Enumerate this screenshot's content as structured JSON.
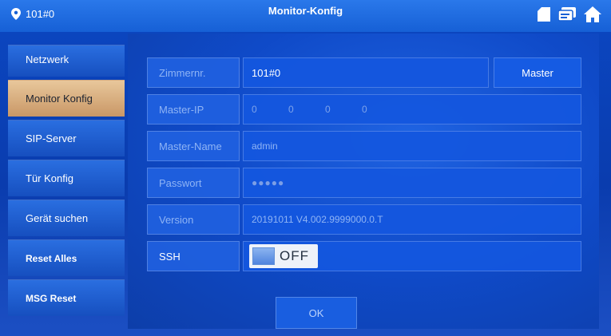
{
  "topbar": {
    "room": "101#0",
    "title": "Monitor-Konfig",
    "icons": [
      "sd-card-icon",
      "message-icon",
      "home-icon"
    ]
  },
  "sidebar": {
    "items": [
      {
        "label": "Netzwerk"
      },
      {
        "label": "Monitor Konfig",
        "active": true
      },
      {
        "label": "SIP-Server"
      },
      {
        "label": "Tür Konfig"
      },
      {
        "label": "Gerät suchen"
      },
      {
        "label": "Reset Alles"
      },
      {
        "label": "MSG Reset"
      }
    ]
  },
  "form": {
    "zimmernr": {
      "label": "Zimmernr.",
      "value": "101#0",
      "button": "Master"
    },
    "master_ip": {
      "label": "Master-IP",
      "octets": [
        "0",
        "0",
        "0",
        "0"
      ]
    },
    "master_name": {
      "label": "Master-Name",
      "value": "admin"
    },
    "passwort": {
      "label": "Passwort",
      "value": "●●●●●"
    },
    "version": {
      "label": "Version",
      "value": "20191011 V4.002.9999000.0.T"
    },
    "ssh": {
      "label": "SSH",
      "state": "OFF"
    }
  },
  "ok_label": "OK",
  "colors": {
    "accent": "#1660d6",
    "active_tab": "#d9ae7f",
    "panel": "#0f4ac8"
  }
}
